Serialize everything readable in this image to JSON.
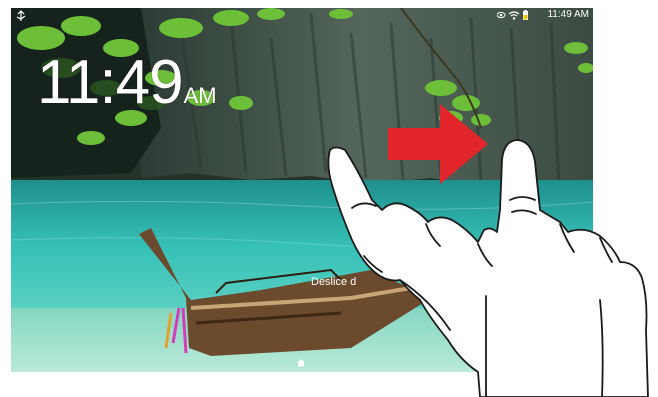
{
  "status_bar": {
    "time": "11:49 AM",
    "icons": [
      "eye-icon",
      "wifi-icon",
      "battery-icon"
    ]
  },
  "lock_screen": {
    "clock_time": "11:49",
    "clock_ampm": "AM",
    "unlock_hint": "Deslice d"
  },
  "colors": {
    "arrow": "#e3262b",
    "water": "#34c0b8",
    "cliff": "#3a4a3e",
    "leaf": "#7cc23a"
  },
  "gesture": {
    "direction": "right",
    "icons": [
      "swipe-arrow-icon",
      "hand-icon"
    ]
  }
}
